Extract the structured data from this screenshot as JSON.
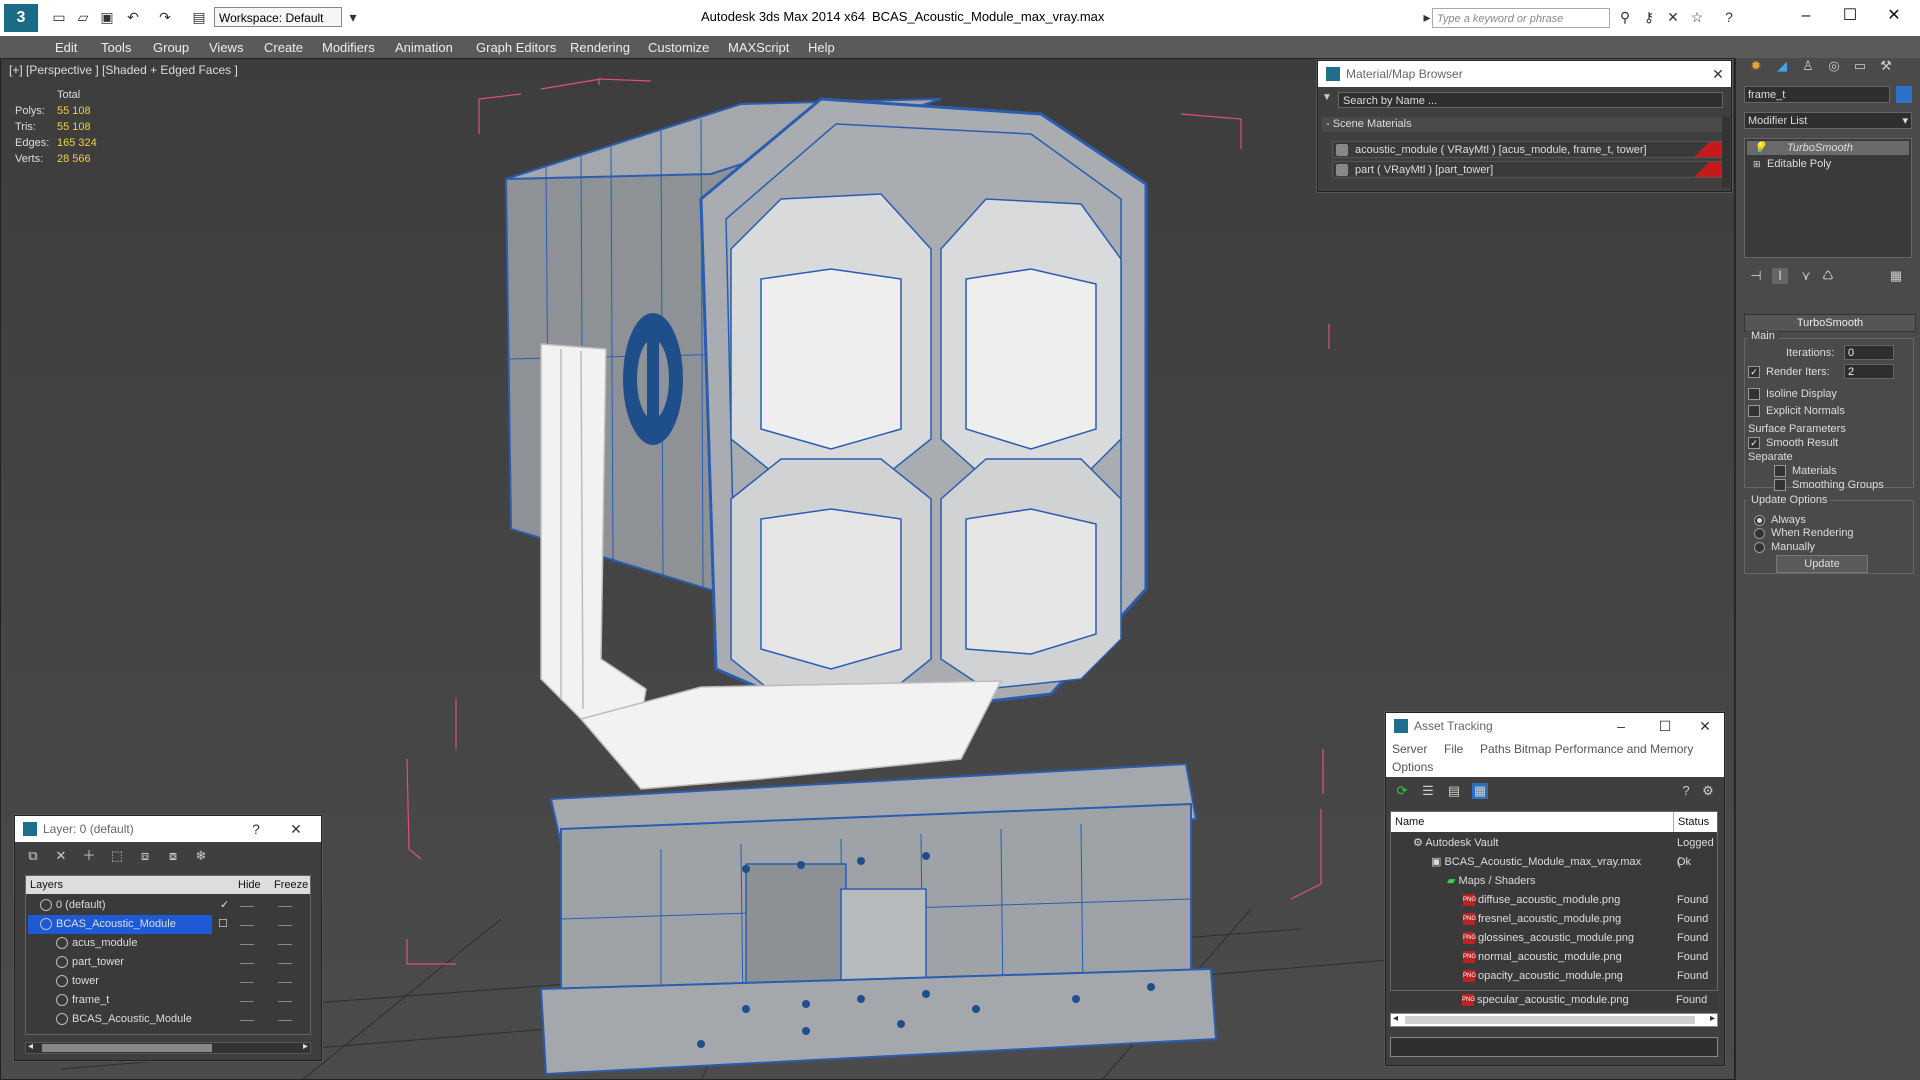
{
  "app": {
    "title": "Autodesk 3ds Max  2014 x64",
    "file_name": "BCAS_Acoustic_Module_max_vray.max",
    "workspace": "Workspace: Default",
    "search_placeholder": "Type a keyword or phrase"
  },
  "menu": [
    "Edit",
    "Tools",
    "Group",
    "Views",
    "Create",
    "Modifiers",
    "Animation",
    "Graph Editors",
    "Rendering",
    "Customize",
    "MAXScript",
    "Help"
  ],
  "viewport": {
    "label": "[+] [Perspective ] [Shaded + Edged Faces ]",
    "stats": {
      "header": "Total",
      "polys_label": "Polys:",
      "polys": "55 108",
      "tris_label": "Tris:",
      "tris": "55 108",
      "edges_label": "Edges:",
      "edges": "165 324",
      "verts_label": "Verts:",
      "verts": "28 566"
    }
  },
  "material_browser": {
    "title": "Material/Map Browser",
    "search_placeholder": "Search by Name ...",
    "section": "- Scene Materials",
    "materials": [
      "acoustic_module  ( VRayMtl )  [acus_module, frame_t, tower]",
      "part  ( VRayMtl )  [part_tower]"
    ]
  },
  "command_panel": {
    "object_name": "frame_t",
    "modifier_list": "Modifier List",
    "stack": [
      "TurboSmooth",
      "Editable Poly"
    ],
    "turbosmooth": {
      "title": "TurboSmooth",
      "main": "Main",
      "iterations_label": "Iterations:",
      "iterations": "0",
      "render_iters_label": "Render Iters:",
      "render_iters": "2",
      "isoline": "Isoline Display",
      "explicit_normals": "Explicit Normals",
      "surface_params": "Surface Parameters",
      "smooth_result": "Smooth Result",
      "separate": "Separate",
      "materials": "Materials",
      "smoothing_groups": "Smoothing Groups",
      "update_options": "Update Options",
      "always": "Always",
      "when_rendering": "When Rendering",
      "manually": "Manually",
      "update_button": "Update"
    }
  },
  "layer_panel": {
    "title": "Layer: 0 (default)",
    "help": "?",
    "col_layers": "Layers",
    "col_hide": "Hide",
    "col_freeze": "Freeze",
    "rows": [
      "0 (default)",
      "BCAS_Acoustic_Module",
      "acus_module",
      "part_tower",
      "tower",
      "frame_t",
      "BCAS_Acoustic_Module"
    ]
  },
  "asset_tracking": {
    "title": "Asset Tracking",
    "menu": [
      "Server",
      "File",
      "Paths",
      "Bitmap Performance and Memory",
      "Options"
    ],
    "col_name": "Name",
    "col_status": "Status",
    "rows": [
      {
        "name": "Autodesk Vault",
        "status": "Logged ("
      },
      {
        "name": "BCAS_Acoustic_Module_max_vray.max",
        "status": "Ok"
      },
      {
        "name": "Maps / Shaders",
        "status": ""
      },
      {
        "name": "diffuse_acoustic_module.png",
        "status": "Found"
      },
      {
        "name": "fresnel_acoustic_module.png",
        "status": "Found"
      },
      {
        "name": "glossines_acoustic_module.png",
        "status": "Found"
      },
      {
        "name": "normal_acoustic_module.png",
        "status": "Found"
      },
      {
        "name": "opacity_acoustic_module.png",
        "status": "Found"
      },
      {
        "name": "specular_acoustic_module.png",
        "status": "Found"
      }
    ]
  },
  "colors": {
    "wire_blue": "#2a5db0",
    "selection_blue": "#1e5ad6",
    "bbox_pink": "#e0507a",
    "stat_yellow": "#f0d040"
  }
}
